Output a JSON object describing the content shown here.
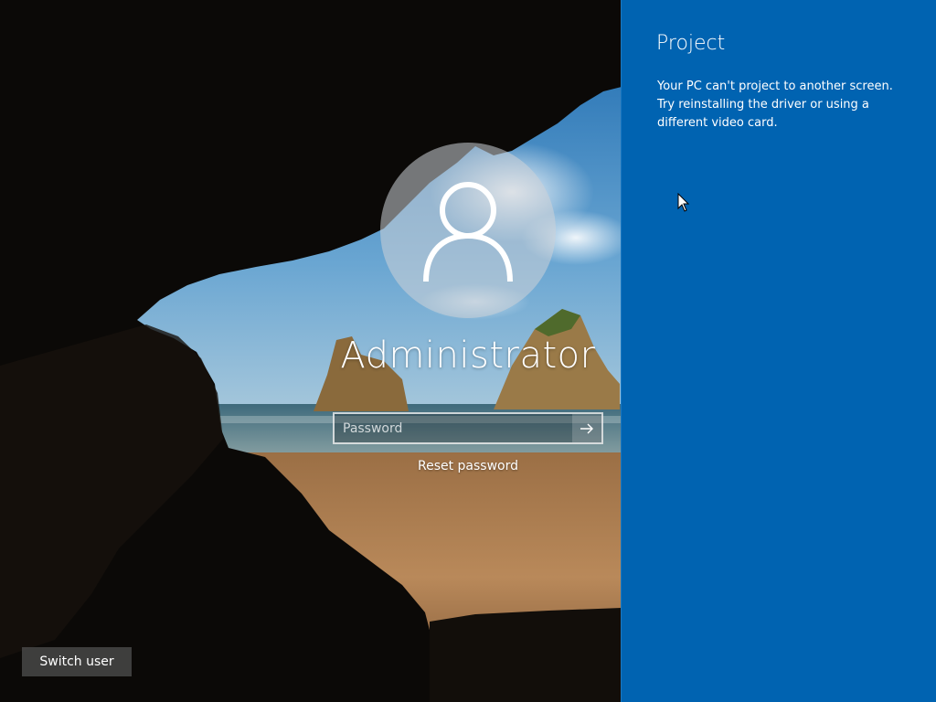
{
  "lock_screen": {
    "username": "Administrator",
    "password_placeholder": "Password",
    "reset_password_label": "Reset password",
    "switch_user_label": "Switch user",
    "submit_icon": "arrow-right-icon",
    "avatar_icon": "user-icon"
  },
  "project_pane": {
    "title": "Project",
    "message": "Your PC can't project to another screen. Try reinstalling the driver or using a different video card.",
    "accent_color": "#0063b1"
  },
  "cursor_icon": "mouse-pointer-icon"
}
